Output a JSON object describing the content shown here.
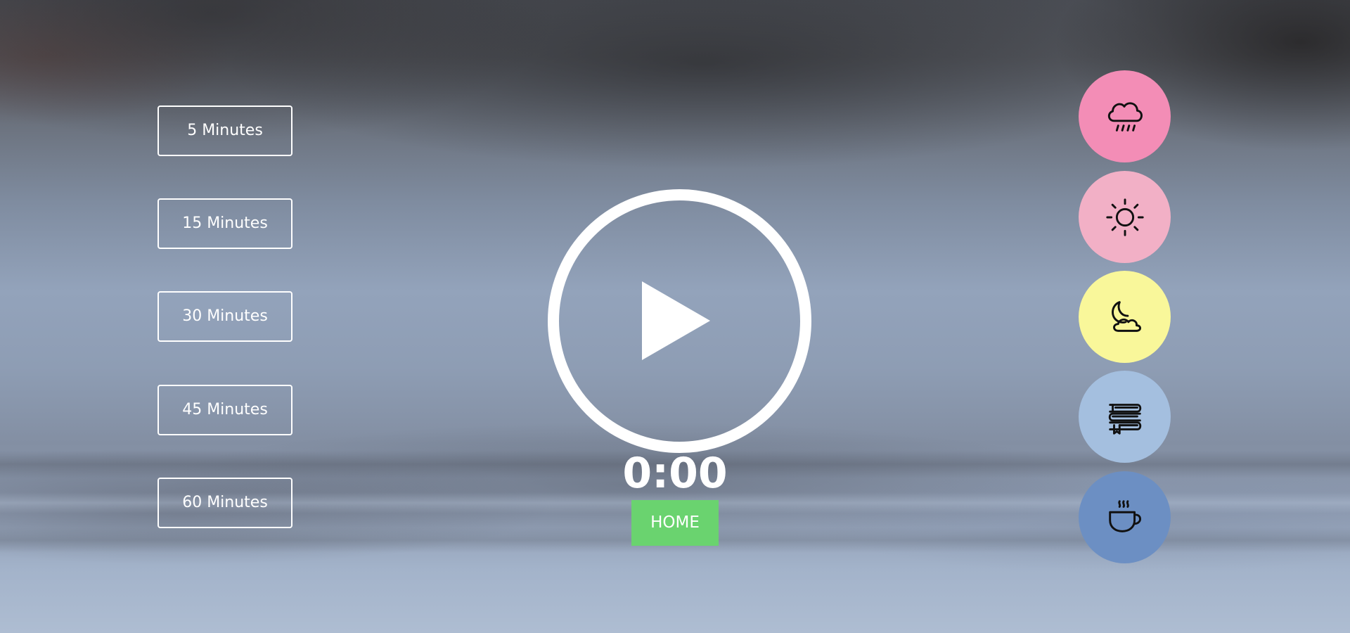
{
  "durations": [
    {
      "label": "5 Minutes"
    },
    {
      "label": "15 Minutes"
    },
    {
      "label": "30 Minutes"
    },
    {
      "label": "45 Minutes"
    },
    {
      "label": "60 Minutes"
    }
  ],
  "player": {
    "play_icon": "play-icon",
    "timer": "0:00",
    "home_label": "HOME"
  },
  "sounds": [
    {
      "icon": "rain-cloud-icon",
      "color": "#f38db6"
    },
    {
      "icon": "sun-icon",
      "color": "#f2b0c6"
    },
    {
      "icon": "moon-cloud-icon",
      "color": "#f9f79a"
    },
    {
      "icon": "books-icon",
      "color": "#a4bfdf"
    },
    {
      "icon": "coffee-cup-icon",
      "color": "#6c8fc3"
    }
  ],
  "colors": {
    "home_button": "#6ad36f",
    "text": "#ffffff"
  }
}
